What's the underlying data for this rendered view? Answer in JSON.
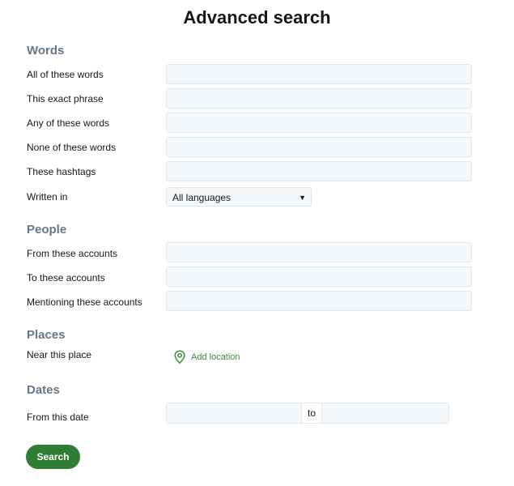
{
  "page": {
    "title": "Advanced search"
  },
  "words": {
    "title": "Words",
    "all_label": "All of these words",
    "all_value": "",
    "exact_label": "This exact phrase",
    "exact_value": "",
    "any_label": "Any of these words",
    "any_value": "",
    "none_label": "None of these words",
    "none_value": "",
    "hashtags_label": "These hashtags",
    "hashtags_value": "",
    "language_label": "Written in",
    "language_selected": "All languages"
  },
  "people": {
    "title": "People",
    "from_label": "From these accounts",
    "from_value": "",
    "to_label": "To these accounts",
    "to_value": "",
    "mentioning_label": "Mentioning these accounts",
    "mentioning_value": ""
  },
  "places": {
    "title": "Places",
    "near_label": "Near this place",
    "add_location_label": "Add location",
    "location_icon": "location-pin-icon",
    "link_color": "#3c8a3c"
  },
  "dates": {
    "title": "Dates",
    "from_label": "From this date",
    "from_value": "",
    "separator": "to",
    "to_value": ""
  },
  "actions": {
    "search_label": "Search",
    "search_color": "#2f7d32"
  },
  "icons": {
    "caret": "caret-down-icon"
  }
}
